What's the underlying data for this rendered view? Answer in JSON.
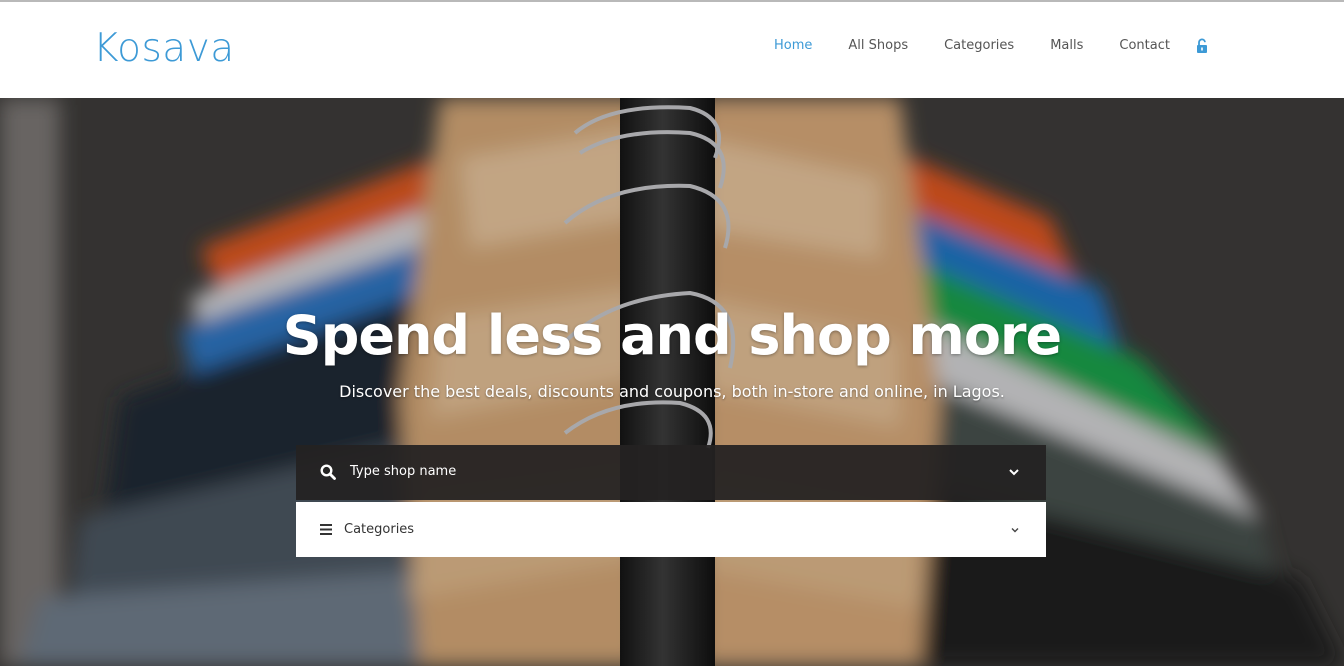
{
  "brand": {
    "logo_text": "Kosava",
    "accent": "#3d9ad6"
  },
  "nav": {
    "items": [
      {
        "label": "Home",
        "active": true
      },
      {
        "label": "All Shops",
        "active": false
      },
      {
        "label": "Categories",
        "active": false
      },
      {
        "label": "Malls",
        "active": false
      },
      {
        "label": "Contact",
        "active": false
      }
    ],
    "login_icon": "lock-open-icon"
  },
  "hero": {
    "headline": "Spend less and shop more",
    "subheadline": "Discover the best deals, discounts and coupons, both in-store and online, in Lagos.",
    "background": "clothes-on-hangers-photo"
  },
  "search": {
    "shop_select_label": "Type shop name",
    "categories_select_label": "Categories"
  }
}
